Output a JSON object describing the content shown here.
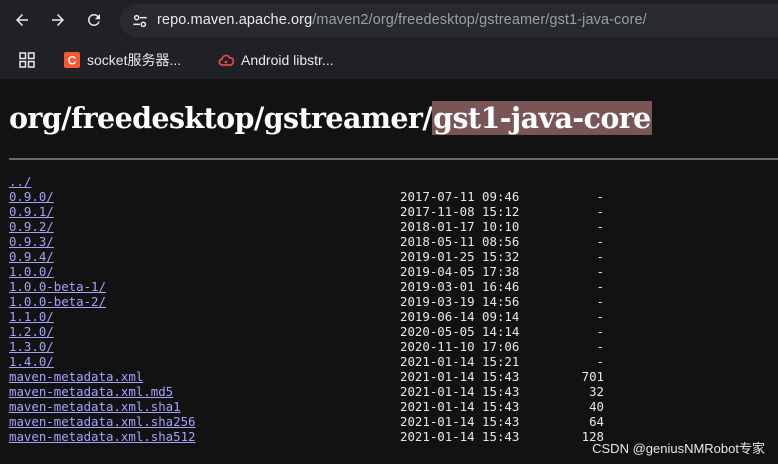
{
  "browser": {
    "url_host": "repo.maven.apache.org",
    "url_path": "/maven2/org/freedesktop/gstreamer/gst1-java-core/",
    "back_icon": "arrow-left-icon",
    "forward_icon": "arrow-right-icon",
    "reload_icon": "reload-icon",
    "site_info_icon": "tune-icon"
  },
  "bookmarks": [
    {
      "label": "socket服务器...",
      "icon": "csdn-c-icon",
      "color": "#fc5531"
    },
    {
      "label": "Android libstr...",
      "icon": "cloud-icon",
      "color": "#e0474c"
    }
  ],
  "page": {
    "title_prefix": "org/freedesktop/gstreamer/",
    "title_highlight": "gst1-java-core",
    "highlight_color": "#7a5555",
    "link_color": "#a4a4ff"
  },
  "listing": [
    {
      "name": "../",
      "date": "",
      "size": ""
    },
    {
      "name": "0.9.0/",
      "date": "2017-07-11 09:46",
      "size": "-"
    },
    {
      "name": "0.9.1/",
      "date": "2017-11-08 15:12",
      "size": "-"
    },
    {
      "name": "0.9.2/",
      "date": "2018-01-17 10:10",
      "size": "-"
    },
    {
      "name": "0.9.3/",
      "date": "2018-05-11 08:56",
      "size": "-"
    },
    {
      "name": "0.9.4/",
      "date": "2019-01-25 15:32",
      "size": "-"
    },
    {
      "name": "1.0.0/",
      "date": "2019-04-05 17:38",
      "size": "-"
    },
    {
      "name": "1.0.0-beta-1/",
      "date": "2019-03-01 16:46",
      "size": "-"
    },
    {
      "name": "1.0.0-beta-2/",
      "date": "2019-03-19 14:56",
      "size": "-"
    },
    {
      "name": "1.1.0/",
      "date": "2019-06-14 09:14",
      "size": "-"
    },
    {
      "name": "1.2.0/",
      "date": "2020-05-05 14:14",
      "size": "-"
    },
    {
      "name": "1.3.0/",
      "date": "2020-11-10 17:06",
      "size": "-"
    },
    {
      "name": "1.4.0/",
      "date": "2021-01-14 15:21",
      "size": "-"
    },
    {
      "name": "maven-metadata.xml",
      "date": "2021-01-14 15:43",
      "size": "701"
    },
    {
      "name": "maven-metadata.xml.md5",
      "date": "2021-01-14 15:43",
      "size": "32"
    },
    {
      "name": "maven-metadata.xml.sha1",
      "date": "2021-01-14 15:43",
      "size": "40"
    },
    {
      "name": "maven-metadata.xml.sha256",
      "date": "2021-01-14 15:43",
      "size": "64"
    },
    {
      "name": "maven-metadata.xml.sha512",
      "date": "2021-01-14 15:43",
      "size": "128"
    }
  ],
  "watermark": "CSDN @geniusNMRobot专家"
}
